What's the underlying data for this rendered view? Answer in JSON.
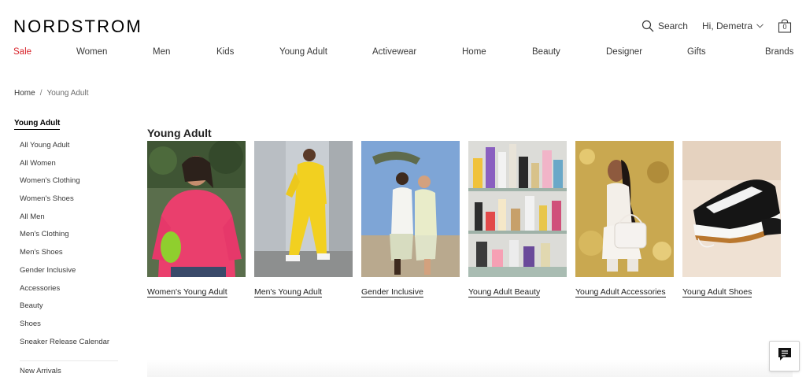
{
  "header": {
    "logo": "NORDSTROM",
    "search_label": "Search",
    "account_label": "Hi, Demetra",
    "bag_count": "0"
  },
  "nav": {
    "items": [
      "Sale",
      "Women",
      "Men",
      "Kids",
      "Young Adult",
      "Activewear",
      "Home",
      "Beauty",
      "Designer",
      "Gifts",
      "Brands"
    ],
    "sale_color": "#d8232a"
  },
  "breadcrumb": {
    "home": "Home",
    "separator": "/",
    "current": "Young Adult"
  },
  "sidebar": {
    "title": "Young Adult",
    "items": [
      "All Young Adult",
      "All Women",
      "Women's Clothing",
      "Women's Shoes",
      "All Men",
      "Men's Clothing",
      "Men's Shoes",
      "Gender Inclusive",
      "Accessories",
      "Beauty",
      "Shoes",
      "Sneaker Release Calendar"
    ],
    "more": "New Arrivals"
  },
  "main": {
    "title": "Young Adult",
    "tiles": [
      {
        "label": "Women's Young Adult"
      },
      {
        "label": "Men's Young Adult"
      },
      {
        "label": "Gender Inclusive"
      },
      {
        "label": "Young Adult Beauty"
      },
      {
        "label": "Young Adult Accessories"
      },
      {
        "label": "Young Adult Shoes"
      }
    ]
  },
  "icons": {
    "search": "search-icon",
    "account_chevron": "chevron-down-icon",
    "bag": "shopping-bag-icon",
    "chat": "chat-icon"
  }
}
